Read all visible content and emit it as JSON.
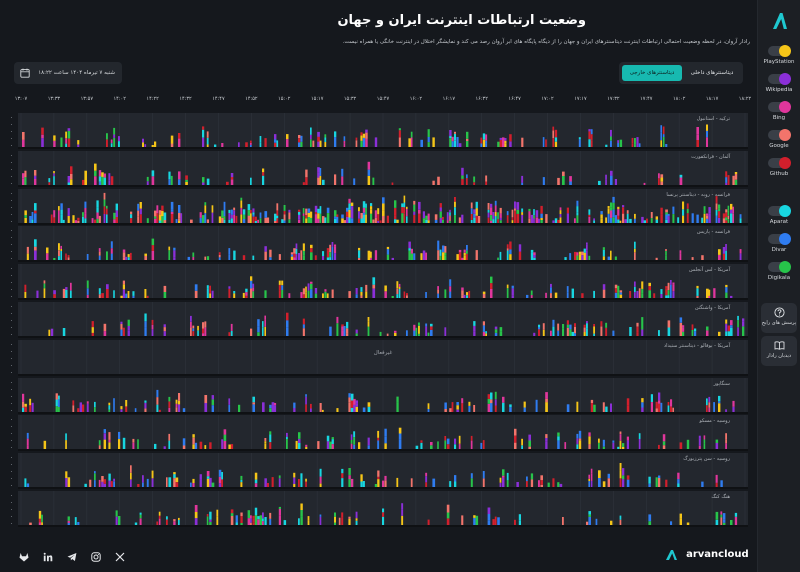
{
  "header": {
    "title": "وضعیت ارتباطات اینترنت ایران و جهان",
    "subtitle": "رادار آروان، در لحظه وضعیت احتمالی ارتباطات اینترنت دیتاسنترهای ایران و جهان را از دیگاه پایگاه های ابر آروان رصد می کند و نمایشگر اختلال در اینترنت خانگی یا همراه نیست."
  },
  "date_picker": {
    "value": "شنبه ۷ تیرماه ۱۴۰۴ ساعت ۱۸:۲۲"
  },
  "tabs": [
    {
      "label": "دیتاسنترهای داخلی",
      "active": false
    },
    {
      "label": "دیتاسنترهای خارجی",
      "active": true
    }
  ],
  "time_ticks": [
    "۱۳:۰۷",
    "۱۳:۳۳",
    "۱۳:۵۷",
    "۱۴:۰۲",
    "۱۴:۲۲",
    "۱۴:۳۲",
    "۱۴:۴۷",
    "۱۴:۵۲",
    "۱۵:۰۲",
    "۱۵:۱۷",
    "۱۵:۳۲",
    "۱۵:۴۷",
    "۱۶:۰۲",
    "۱۶:۱۷",
    "۱۶:۳۲",
    "۱۶:۴۷",
    "۱۷:۰۲",
    "۱۷:۱۷",
    "۱۷:۳۲",
    "۱۷:۴۷",
    "۱۸:۰۲",
    "۱۸:۱۷",
    "۱۸:۲۲"
  ],
  "panels": [
    {
      "label": "ترکیه - استانبول",
      "available": true
    },
    {
      "label": "آلمان - فرانکفورت",
      "available": true
    },
    {
      "label": "فرانسه - روبه - دیتاسنتر پرنسا",
      "available": true
    },
    {
      "label": "فرانسه - پاریس",
      "available": true
    },
    {
      "label": "آمریکا - لس آنجلس",
      "available": true
    },
    {
      "label": "آمریکا - واشنگتن",
      "available": true
    },
    {
      "label": "آمریکا - بوفالو - دیتاسنتر ستیداد",
      "available": false,
      "status": "غیرفعال"
    },
    {
      "label": "سنگاپور",
      "available": true
    },
    {
      "label": "روسیه - مسکو",
      "available": true
    },
    {
      "label": "روسیه - سن پترزبورگ",
      "available": true
    },
    {
      "label": "هنگ کنگ",
      "available": true
    }
  ],
  "services": [
    {
      "name": "PlayStation",
      "color": "#f5c518",
      "icon": "toggle-on"
    },
    {
      "name": "Wikipedia",
      "color": "#8b2fd8",
      "icon": "toggle-on"
    },
    {
      "name": "Bing",
      "color": "#e0369c",
      "icon": "toggle-on"
    },
    {
      "name": "Google",
      "color": "#f2746b",
      "icon": "toggle-on"
    },
    {
      "name": "Github",
      "color": "#d21f2c",
      "icon": "toggle-on"
    },
    {
      "name": "Aparat",
      "color": "#18d6e0",
      "icon": "toggle-on"
    },
    {
      "name": "Divar",
      "color": "#2f7cf0",
      "icon": "toggle-on"
    },
    {
      "name": "Digikala",
      "color": "#27c44a",
      "icon": "toggle-on"
    }
  ],
  "sidebar_buttons": [
    {
      "label": "پرسش های رایج",
      "icon": "question-icon"
    },
    {
      "label": "دیدبان رادار",
      "icon": "book-icon"
    }
  ],
  "footer": {
    "brand": "arvancloud",
    "social": [
      "gitlab-icon",
      "linkedin-icon",
      "telegram-icon",
      "instagram-icon",
      "x-icon"
    ]
  },
  "chart_data": {
    "type": "bar",
    "x_ticks": [
      "۱۳:۰۷",
      "۱۳:۳۳",
      "۱۳:۵۷",
      "۱۴:۰۲",
      "۱۴:۲۲",
      "۱۴:۳۲",
      "۱۴:۴۷",
      "۱۴:۵۲",
      "۱۵:۰۲",
      "۱۵:۱۷",
      "۱۵:۳۲",
      "۱۵:۴۷",
      "۱۶:۰۲",
      "۱۶:۱۷",
      "۱۶:۳۲",
      "۱۶:۴۷",
      "۱۷:۰۲",
      "۱۷:۱۷",
      "۱۷:۳۲",
      "۱۷:۴۷",
      "۱۸:۰۲",
      "۱۸:۱۷",
      "۱۸:۲۲"
    ],
    "series": [
      {
        "name": "PlayStation",
        "color": "#f5c518"
      },
      {
        "name": "Wikipedia",
        "color": "#8b2fd8"
      },
      {
        "name": "Bing",
        "color": "#e0369c"
      },
      {
        "name": "Google",
        "color": "#f2746b"
      },
      {
        "name": "Github",
        "color": "#d21f2c"
      },
      {
        "name": "Aparat",
        "color": "#18d6e0"
      },
      {
        "name": "Divar",
        "color": "#2f7cf0"
      },
      {
        "name": "Digikala",
        "color": "#27c44a"
      }
    ],
    "density": [
      0.22,
      0.2,
      0.62,
      0.3,
      0.28,
      0.27,
      0.0,
      0.3,
      0.28,
      0.3,
      0.26
    ]
  }
}
